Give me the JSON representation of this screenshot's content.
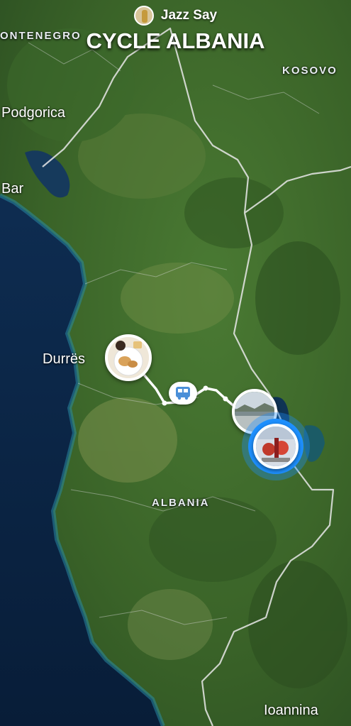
{
  "header": {
    "author_name": "Jazz Say",
    "title": "CYCLE ALBANIA",
    "avatar_icon": "profile-avatar-icon"
  },
  "map": {
    "countries": {
      "montenegro": "ONTENEGRO",
      "kosovo": "KOSOVO",
      "albania": "ALBANIA"
    },
    "cities": {
      "podgorica": "Podgorica",
      "bar": "Bar",
      "durres": "Durrës",
      "ioannina": "Ioannina"
    },
    "colors": {
      "sea": "#0b2a4c",
      "land": "#3f6a2c",
      "border": "#e8e8e8",
      "route": "#ffffff",
      "current_ring": "#1e90ff"
    },
    "markers": {
      "photo_pins": [
        "breakfast-photo",
        "lake-photo",
        "bike-photo-current"
      ],
      "transit_icon": "bus-icon"
    }
  }
}
